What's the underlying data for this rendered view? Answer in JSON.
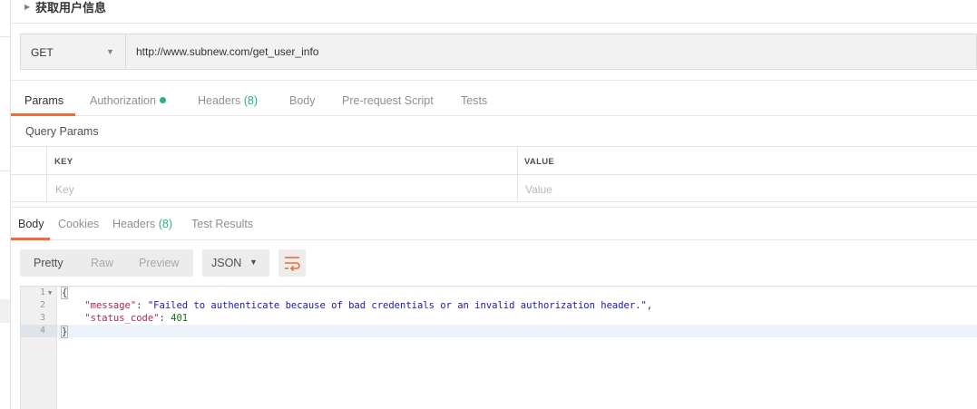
{
  "request": {
    "title": "获取用户信息",
    "method": "GET",
    "url": "http://www.subnew.com/get_user_info"
  },
  "request_tabs": {
    "params": "Params",
    "authorization": "Authorization",
    "headers": "Headers",
    "headers_count": "(8)",
    "body": "Body",
    "pre_request_script": "Pre-request Script",
    "tests": "Tests"
  },
  "query_params": {
    "label": "Query Params",
    "key_header": "KEY",
    "value_header": "VALUE",
    "key_placeholder": "Key",
    "value_placeholder": "Value"
  },
  "response_tabs": {
    "body": "Body",
    "cookies": "Cookies",
    "headers": "Headers",
    "headers_count": "(8)",
    "test_results": "Test Results"
  },
  "format_bar": {
    "pretty": "Pretty",
    "raw": "Raw",
    "preview": "Preview",
    "language": "JSON"
  },
  "editor": {
    "line_numbers": [
      "1",
      "2",
      "3",
      "4"
    ],
    "open_brace": "{",
    "close_brace": "}",
    "message_key": "\"message\"",
    "message_value": "\"Failed to authenticate because of bad credentials or an invalid authorization header.\"",
    "status_key": "\"status_code\"",
    "status_value": "401"
  },
  "colors": {
    "accent": "#f26b3a",
    "count_green": "#26b47f"
  }
}
